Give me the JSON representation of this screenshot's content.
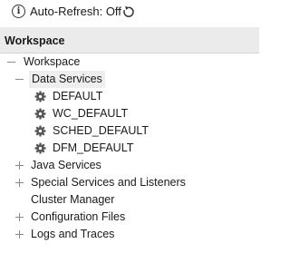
{
  "toolbar": {
    "info_icon": "info-icon",
    "auto_refresh_label": "Auto-Refresh: Off",
    "refresh_icon": "refresh-icon"
  },
  "workspace": {
    "header": "Workspace",
    "tree": {
      "root": "Workspace",
      "data_services": {
        "label": "Data Services",
        "expanded": true,
        "children": [
          "DEFAULT",
          "WC_DEFAULT",
          "SCHED_DEFAULT",
          "DFM_DEFAULT"
        ]
      },
      "java_services": "Java Services",
      "special_services": "Special Services and Listeners",
      "cluster_manager": "Cluster Manager",
      "configuration_files": "Configuration Files",
      "logs_and_traces": "Logs and Traces"
    }
  },
  "colors": {
    "header_bg": "#ebebeb",
    "selected_bg": "#eeeeee",
    "icon": "#555555"
  }
}
